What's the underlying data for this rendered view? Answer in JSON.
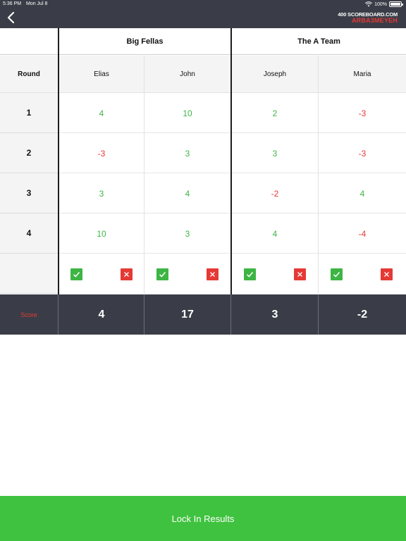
{
  "status": {
    "time": "5:36 PM",
    "date": "Mon Jul 8",
    "battery": "100%"
  },
  "brand": {
    "line1": "400 SCOREBOARD.COM",
    "line2": "ARBA3MEYEH"
  },
  "teams": [
    {
      "name": "Big Fellas"
    },
    {
      "name": "The A Team"
    }
  ],
  "header": {
    "round_label": "Round",
    "players": [
      "Elias",
      "John",
      "Joseph",
      "Maria"
    ]
  },
  "rounds": [
    {
      "round": "1",
      "values": [
        "4",
        "10",
        "2",
        "-3"
      ]
    },
    {
      "round": "2",
      "values": [
        "-3",
        "3",
        "3",
        "-3"
      ]
    },
    {
      "round": "3",
      "values": [
        "3",
        "4",
        "-2",
        "4"
      ]
    },
    {
      "round": "4",
      "values": [
        "10",
        "3",
        "4",
        "-4"
      ]
    }
  ],
  "score": {
    "label": "Score",
    "values": [
      "4",
      "17",
      "3",
      "-2"
    ]
  },
  "lock_button": "Lock In Results",
  "colors": {
    "positive": "#3db544",
    "negative": "#e53935",
    "dark": "#3a3d47",
    "lock": "#3fc23f"
  }
}
